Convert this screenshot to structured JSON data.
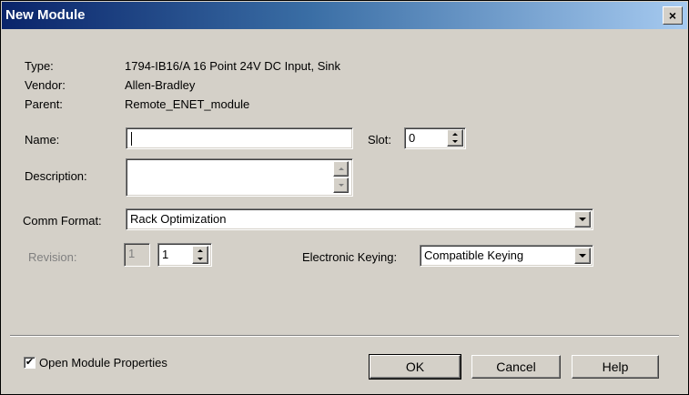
{
  "window": {
    "title": "New Module",
    "close_label": "×"
  },
  "info": {
    "type_label": "Type:",
    "type_value": "1794-IB16/A 16 Point 24V DC Input, Sink",
    "vendor_label": "Vendor:",
    "vendor_value": "Allen-Bradley",
    "parent_label": "Parent:",
    "parent_value": "Remote_ENET_module"
  },
  "form": {
    "name_label": "Name:",
    "name_value": "",
    "slot_label": "Slot:",
    "slot_value": "0",
    "description_label": "Description:",
    "description_value": "",
    "comm_format_label": "Comm Format:",
    "comm_format_value": "Rack Optimization",
    "revision_label": "Revision:",
    "revision_major": "1",
    "revision_minor": "1",
    "keying_label": "Electronic Keying:",
    "keying_value": "Compatible Keying"
  },
  "footer": {
    "open_props_label": "Open Module Properties",
    "open_props_checked": true,
    "check_glyph": "✔",
    "ok_label": "OK",
    "cancel_label": "Cancel",
    "help_label": "Help"
  }
}
